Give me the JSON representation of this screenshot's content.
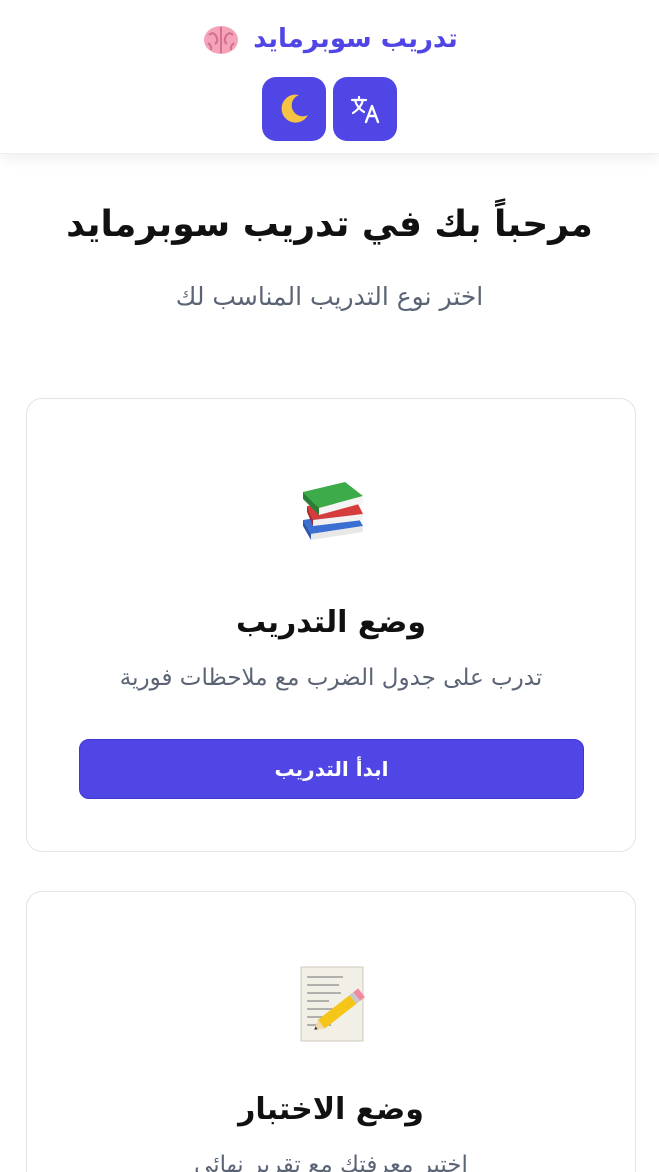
{
  "header": {
    "brand_title": "تدريب سوبرمايد",
    "brand_icon": "brain-icon",
    "language_button_icon": "translate-icon",
    "theme_button_icon": "moon-icon"
  },
  "hero": {
    "title": "مرحباً بك في تدريب سوبرمايد",
    "subtitle": "اختر نوع التدريب المناسب لك"
  },
  "modes": [
    {
      "icon": "books-icon",
      "title": "وضع التدريب",
      "description": "تدرب على جدول الضرب مع ملاحظات فورية",
      "button_label": "ابدأ التدريب"
    },
    {
      "icon": "memo-pencil-icon",
      "title": "وضع الاختبار",
      "description": "اختبر معرفتك مع تقرير نهائي"
    }
  ],
  "colors": {
    "accent": "#4f46e5",
    "brand_text": "#5146e5",
    "muted_text": "#5b6475",
    "card_border": "#e2e4ea"
  }
}
